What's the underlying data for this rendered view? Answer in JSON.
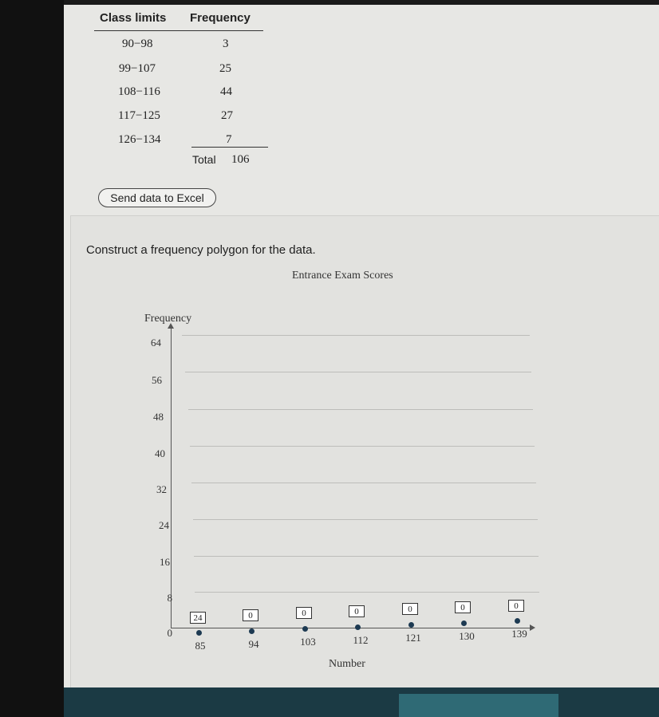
{
  "table": {
    "headers": [
      "Class limits",
      "Frequency"
    ],
    "rows": [
      {
        "limits": "90−98",
        "frequency": "3"
      },
      {
        "limits": "99−107",
        "frequency": "25"
      },
      {
        "limits": "108−116",
        "frequency": "44"
      },
      {
        "limits": "117−125",
        "frequency": "27"
      },
      {
        "limits": "126−134",
        "frequency": "7"
      }
    ],
    "total_label": "Total",
    "total_value": "106"
  },
  "excel_button": "Send data to Excel",
  "instruction": "Construct a frequency polygon for the data.",
  "chart": {
    "title": "Entrance Exam Scores",
    "y_title": "Frequency",
    "x_title": "Number",
    "y_ticks": [
      "64",
      "56",
      "48",
      "40",
      "32",
      "24",
      "16",
      "8",
      "0"
    ],
    "x_ticks": [
      "85",
      "94",
      "103",
      "112",
      "121",
      "130",
      "139"
    ],
    "inputs": [
      "24",
      "0",
      "0",
      "0",
      "0",
      "0",
      "0"
    ]
  },
  "chart_data": {
    "type": "line",
    "title": "Entrance Exam Scores",
    "xlabel": "Number",
    "ylabel": "Frequency",
    "x": [
      85,
      94,
      103,
      112,
      121,
      130,
      139
    ],
    "values": [
      0,
      0,
      0,
      0,
      0,
      0,
      0
    ],
    "ylim": [
      0,
      64
    ],
    "grid": true
  }
}
